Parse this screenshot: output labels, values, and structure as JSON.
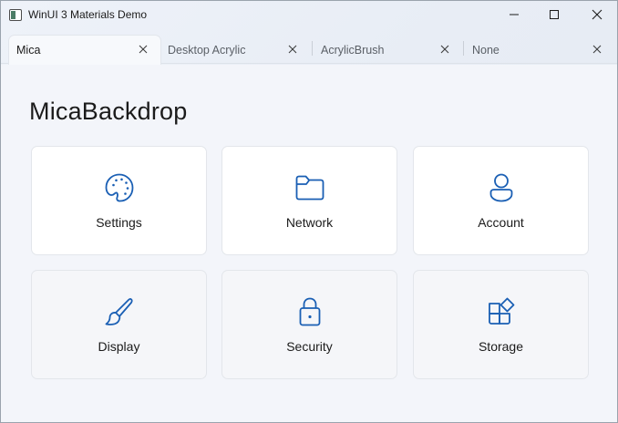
{
  "window": {
    "title": "WinUI 3 Materials Demo",
    "accent_color": "#1a5fb4"
  },
  "caption_buttons": [
    {
      "name": "minimize",
      "icon": "minimize-icon"
    },
    {
      "name": "maximize",
      "icon": "maximize-icon"
    },
    {
      "name": "close",
      "icon": "close-icon"
    }
  ],
  "tabs": [
    {
      "label": "Mica",
      "selected": true
    },
    {
      "label": "Desktop Acrylic",
      "selected": false
    },
    {
      "label": "AcrylicBrush",
      "selected": false
    },
    {
      "label": "None",
      "selected": false
    }
  ],
  "page": {
    "title": "MicaBackdrop"
  },
  "cards": [
    {
      "label": "Settings",
      "icon": "palette-icon"
    },
    {
      "label": "Network",
      "icon": "folder-icon"
    },
    {
      "label": "Account",
      "icon": "person-icon"
    },
    {
      "label": "Display",
      "icon": "brush-icon"
    },
    {
      "label": "Security",
      "icon": "lock-icon"
    },
    {
      "label": "Storage",
      "icon": "apps-icon"
    }
  ]
}
